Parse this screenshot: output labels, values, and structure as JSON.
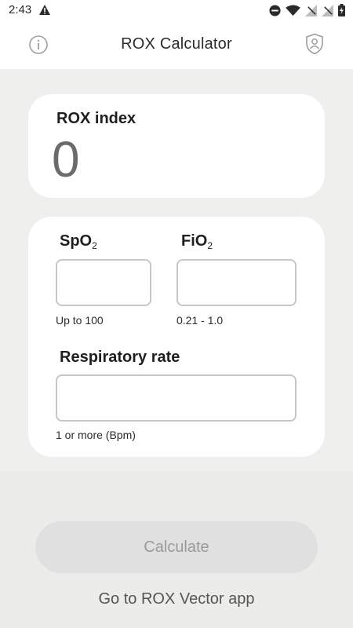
{
  "status_bar": {
    "time": "2:43",
    "icons": [
      "warning-icon",
      "do-not-disturb-icon",
      "wifi-icon",
      "signal-off-icon",
      "signal-off-icon",
      "battery-icon"
    ]
  },
  "app_bar": {
    "title": "ROX Calculator",
    "left_icon": "info-icon",
    "right_icon": "shield-user-icon"
  },
  "rox_card": {
    "label": "ROX index",
    "value": "0"
  },
  "inputs": {
    "spo2": {
      "label_main": "SpO",
      "label_sub": "2",
      "value": "",
      "hint": "Up to 100"
    },
    "fio2": {
      "label_main": "FiO",
      "label_sub": "2",
      "value": "",
      "hint": "0.21 - 1.0"
    },
    "respiratory_rate": {
      "label": "Respiratory rate",
      "value": "",
      "hint": "1 or more (Bpm)"
    }
  },
  "actions": {
    "calculate_label": "Calculate",
    "vector_link_label": "Go to ROX Vector app"
  },
  "colors": {
    "background": "#efefed",
    "card": "#ffffff",
    "button_disabled": "#e0e0e0",
    "button_text_disabled": "#9a9a9a",
    "input_border": "#c7c7c7"
  }
}
